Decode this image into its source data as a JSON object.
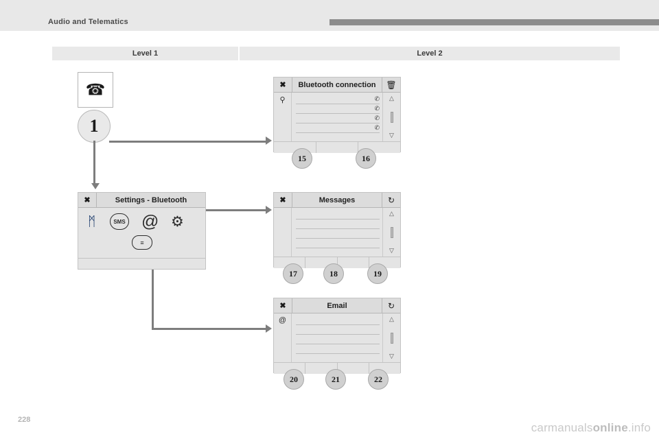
{
  "header": {
    "title": "Audio and Telematics"
  },
  "level_table": {
    "level1": "Level 1",
    "level2": "Level 2"
  },
  "level1": {
    "phone_icon": "phone-handset-icon",
    "step_number": "1",
    "settings_screen": {
      "close_label": "✖",
      "title": "Settings - Bluetooth",
      "icons": [
        {
          "name": "bluetooth-icon",
          "glyph": "ᛗ"
        },
        {
          "name": "sms-icon",
          "label": "SMS"
        },
        {
          "name": "email-at-icon",
          "glyph": "@"
        },
        {
          "name": "gear-icon",
          "glyph": "⚙"
        },
        {
          "name": "chat-bubble-icon",
          "glyph": "≡"
        }
      ]
    }
  },
  "screens": [
    {
      "key": "bluetooth",
      "close_label": "✖",
      "title": "Bluetooth connection",
      "right_icon": "trash-icon",
      "right_glyph": "🗑",
      "left_icon": "search-icon",
      "left_glyph": "⚲",
      "rows": [
        {
          "label": "",
          "icon": "✆"
        },
        {
          "label": "",
          "icon": "✆"
        },
        {
          "label": "",
          "icon": "✆"
        },
        {
          "label": "",
          "icon": "✆"
        }
      ],
      "scroll_up": "△",
      "scroll_down": "▽",
      "callouts": [
        "15",
        "16"
      ]
    },
    {
      "key": "messages",
      "close_label": "✖",
      "title": "Messages",
      "right_icon": "refresh-icon",
      "right_glyph": "↻",
      "left_icon": "",
      "left_glyph": "",
      "rows": [
        {
          "label": "",
          "icon": ""
        },
        {
          "label": "",
          "icon": ""
        },
        {
          "label": "",
          "icon": ""
        },
        {
          "label": "",
          "icon": ""
        }
      ],
      "scroll_up": "△",
      "scroll_down": "▽",
      "callouts": [
        "17",
        "18",
        "19"
      ]
    },
    {
      "key": "email",
      "close_label": "✖",
      "title": "Email",
      "right_icon": "refresh-icon",
      "right_glyph": "↻",
      "left_icon": "email-at-icon",
      "left_glyph": "@",
      "rows": [
        {
          "label": "",
          "icon": ""
        },
        {
          "label": "",
          "icon": ""
        },
        {
          "label": "",
          "icon": ""
        },
        {
          "label": "",
          "icon": ""
        }
      ],
      "scroll_up": "△",
      "scroll_down": "▽",
      "callouts": [
        "20",
        "21",
        "22"
      ]
    }
  ],
  "footer": {
    "page_number": "228",
    "watermark_plain": "carmanuals",
    "watermark_bold": "online",
    "watermark_suffix": ".info"
  },
  "colors": {
    "header_bg": "#e8e8e8",
    "header_bar": "#8c8c8c",
    "screen_bg": "#e4e4e4",
    "connector": "#7d7d7d",
    "callout_bg": "#d0d0d0"
  }
}
